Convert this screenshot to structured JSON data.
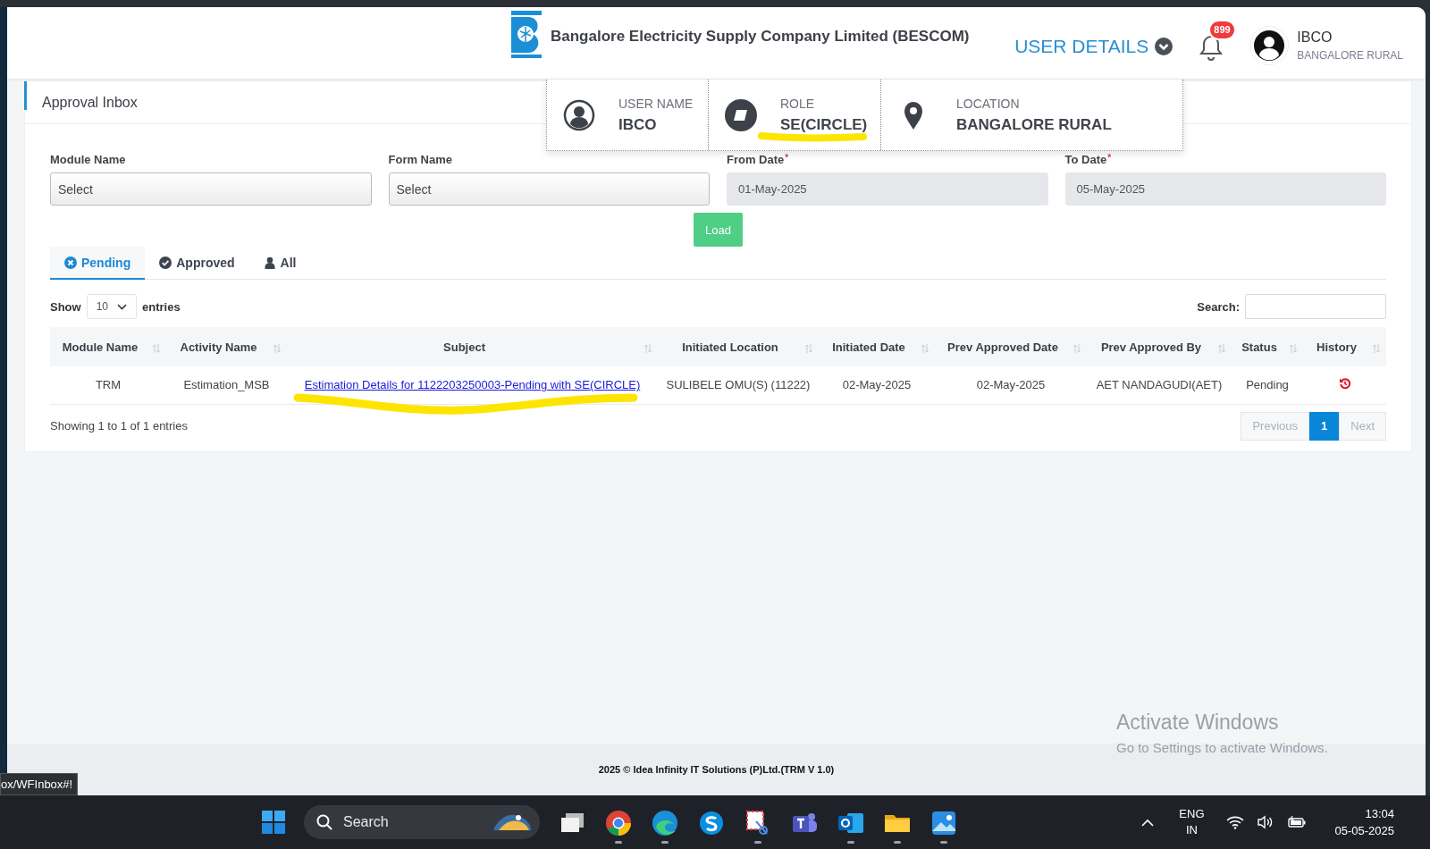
{
  "header": {
    "title": "Bangalore Electricity Supply Company Limited (BESCOM)",
    "user_details": "USER DETAILS",
    "notification_count": "899",
    "user": {
      "name": "IBCO",
      "location": "BANGALORE RURAL"
    }
  },
  "user_details_popup": [
    {
      "kind": "user",
      "label": "USER NAME",
      "value": "IBCO",
      "highlighted": false
    },
    {
      "kind": "role",
      "label": "ROLE",
      "value": "SE(CIRCLE)",
      "highlighted": true
    },
    {
      "kind": "location",
      "label": "LOCATION",
      "value": "BANGALORE RURAL",
      "highlighted": false
    }
  ],
  "page_title": "Approval Inbox",
  "filters": [
    {
      "label": "Module Name",
      "disabled": false,
      "value": "Select"
    },
    {
      "label": "Form Name",
      "disabled": false,
      "value": "Select"
    },
    {
      "label": "From Date",
      "required_mark": "*",
      "disabled": true,
      "value": "01-May-2025"
    },
    {
      "label": "To Date",
      "required_mark": "*",
      "disabled": true,
      "value": "05-May-2025"
    }
  ],
  "load_button": "Load",
  "tabs": [
    {
      "kind": "pending",
      "label": "Pending",
      "selected": true
    },
    {
      "kind": "approved",
      "label": "Approved",
      "selected": false
    },
    {
      "kind": "all",
      "label": "All",
      "selected": false
    }
  ],
  "length_menu": {
    "prefix": "Show",
    "value": "10",
    "suffix": "entries"
  },
  "search": {
    "label": "Search:"
  },
  "table": {
    "columns": [
      "Module Name",
      "Activity Name",
      "Subject",
      "Initiated Location",
      "Initiated Date",
      "Prev Approved Date",
      "Prev Approved By",
      "Status",
      "History"
    ],
    "rows": [
      {
        "module": "TRM",
        "activity": "Estimation_MSB",
        "subject": "Estimation Details for 1122203250003-Pending with SE(CIRCLE)",
        "subject_highlighted": true,
        "location": "SULIBELE OMU(S) (11222)",
        "initiated_date": "02-May-2025",
        "prev_approved_date": "02-May-2025",
        "prev_approved_by": "AET NANDAGUDI(AET)",
        "status": "Pending"
      }
    ]
  },
  "info": "Showing 1 to 1 of 1 entries",
  "pagination": [
    {
      "label": "Previous",
      "selected": false,
      "disabled": true
    },
    {
      "label": "1",
      "selected": true,
      "disabled": false
    },
    {
      "label": "Next",
      "selected": false,
      "disabled": true
    }
  ],
  "footer": "2025 © Idea Infinity IT Solutions (P)Ltd.(TRM V 1.0)",
  "link_tooltip": "ox/WFInbox#!",
  "activation_notice": {
    "title": "Activate Windows",
    "subtitle": "Go to Settings to activate Windows."
  },
  "taskbar": {
    "search": "Search",
    "apps": [
      {
        "kind": "taskview",
        "running": false
      },
      {
        "kind": "chrome",
        "running": true
      },
      {
        "kind": "edge",
        "running": true
      },
      {
        "kind": "skype",
        "running": false
      },
      {
        "kind": "snip",
        "running": true
      },
      {
        "kind": "teams",
        "running": false
      },
      {
        "kind": "outlook",
        "running": true
      },
      {
        "kind": "explorer",
        "running": true
      },
      {
        "kind": "photos",
        "running": true
      }
    ],
    "language": "ENG",
    "region": "IN",
    "time": "13:04",
    "date": "05-05-2025"
  }
}
